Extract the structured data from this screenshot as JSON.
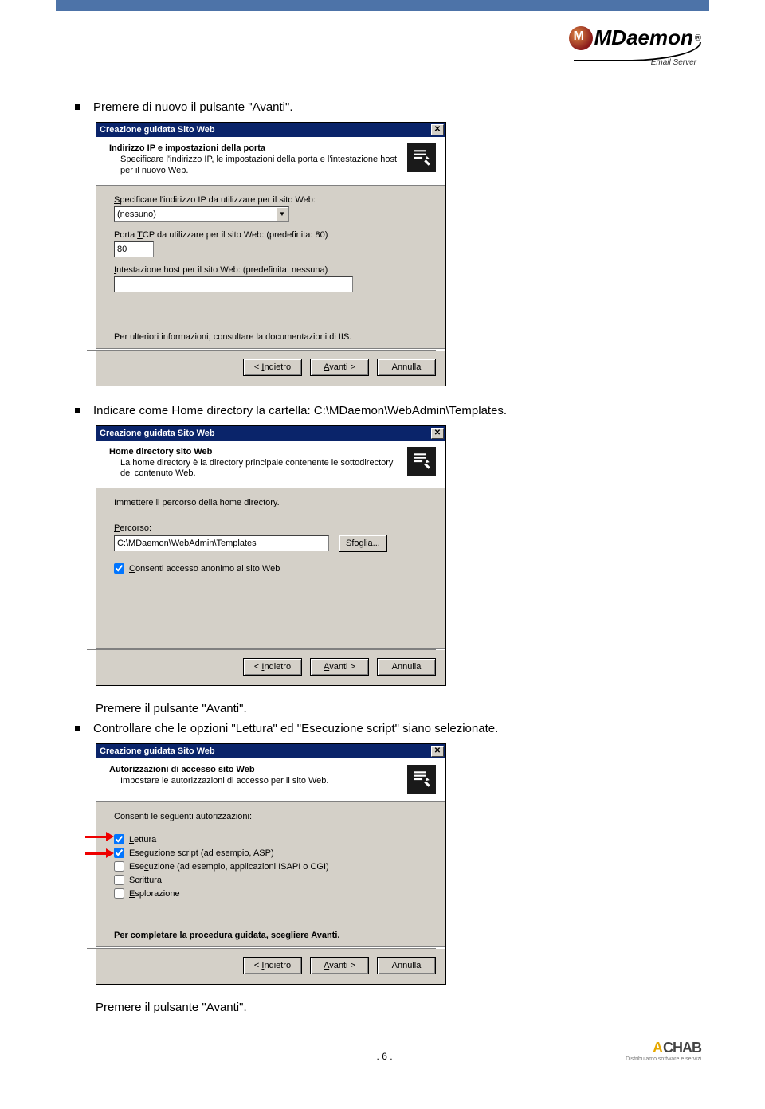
{
  "logo": {
    "text": "MDaemon",
    "reg": "®",
    "sub": "Email Server"
  },
  "bullets": {
    "b1": "Premere di nuovo il pulsante \"Avanti\".",
    "b2": "Indicare come Home directory la cartella: C:\\MDaemon\\WebAdmin\\Templates.",
    "b3": "Controllare che le opzioni \"Lettura\" ed \"Esecuzione script\" siano selezionate."
  },
  "indent": {
    "p2": "Premere il pulsante \"Avanti\".",
    "p3": "Premere il pulsante \"Avanti\"."
  },
  "dialog_common": {
    "title": "Creazione guidata Sito Web",
    "btn_back": "< Indietro",
    "btn_next": "Avanti >",
    "btn_cancel": "Annulla"
  },
  "d1": {
    "htitle": "Indirizzo IP e impostazioni della porta",
    "hsub": "Specificare l'indirizzo IP, le impostazioni della porta e l'intestazione host per il nuovo Web.",
    "lbl_ip_pre": "Specificare l'indirizzo IP da utilizzare per il sito Web:",
    "ip_underline": "S",
    "ip_value": "(nessuno)",
    "lbl_port_pre": "Porta ",
    "lbl_port_u": "T",
    "lbl_port_post": "CP da utilizzare per il sito Web: (predefinita: 80)",
    "port_value": "80",
    "lbl_host_u": "I",
    "lbl_host_post": "ntestazione host per il sito Web: (predefinita: nessuna)",
    "host_value": "",
    "footer_info": "Per ulteriori informazioni, consultare la documentazioni di IIS."
  },
  "d2": {
    "htitle": "Home directory sito Web",
    "hsub": "La home directory è la directory principale contenente le sottodirectory del contenuto Web.",
    "lbl_intro": "Immettere il percorso della home directory.",
    "lbl_path_u": "P",
    "lbl_path_post": "ercorso:",
    "path_value": "C:\\MDaemon\\WebAdmin\\Templates",
    "sfoglia": "Sfoglia...",
    "sfoglia_u": "S",
    "chk_u": "C",
    "chk_post": "onsenti accesso anonimo al sito Web"
  },
  "d3": {
    "htitle": "Autorizzazioni di accesso sito Web",
    "hsub": "Impostare le autorizzazioni di accesso per il sito Web.",
    "lbl_intro": "Consenti le seguenti autorizzazioni:",
    "opt1_u": "L",
    "opt1_post": "ettura",
    "opt2_post": "Esecuzione script (ad esempio, ASP)",
    "opt2_u": "g",
    "opt3_post": "Esecuzione (ad esempio, applicazioni ISAPI o CGI)",
    "opt3_u": "c",
    "opt4_u": "S",
    "opt4_post": "crittura",
    "opt5_u": "E",
    "opt5_post": "splorazione",
    "complete": "Per completare la procedura guidata, scegliere Avanti."
  },
  "footer": {
    "page": ". 6 .",
    "achab": "CHAB",
    "achab_a": "A",
    "tag": "Distribuiamo software e servizi"
  }
}
